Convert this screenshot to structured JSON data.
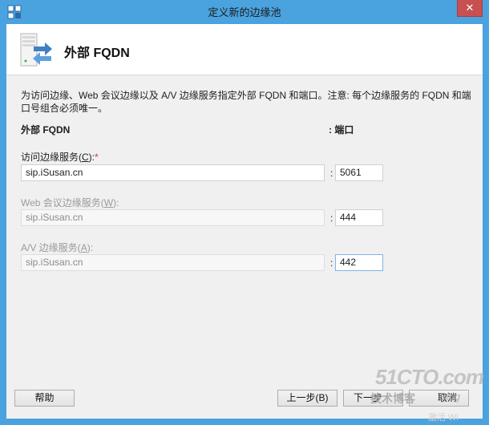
{
  "window": {
    "title": "定义新的边缘池",
    "close_label": "✕"
  },
  "header": {
    "title": "外部 FQDN",
    "icon": "server-arrow-icon"
  },
  "description": "为访问边缘、Web 会议边缘以及 A/V 边缘服务指定外部 FQDN 和端口。注意: 每个边缘服务的 FQDN 和端口号组合必须唯一。",
  "columns": {
    "fqdn": "外部 FQDN",
    "port": ": 端口"
  },
  "fields": [
    {
      "label_prefix": "访问边缘服务(",
      "label_key": "C",
      "label_suffix": "):",
      "required_mark": "*",
      "fqdn": "sip.iSusan.cn",
      "port": "5061",
      "enabled": true
    },
    {
      "label_prefix": "Web 会议边缘服务(",
      "label_key": "W",
      "label_suffix": "):",
      "required_mark": "",
      "fqdn": "sip.iSusan.cn",
      "port": "444",
      "enabled": false
    },
    {
      "label_prefix": "A/V 边缘服务(",
      "label_key": "A",
      "label_suffix": "):",
      "required_mark": "",
      "fqdn": "sip.iSusan.cn",
      "port": "442",
      "enabled": false
    }
  ],
  "colon": ":",
  "buttons": {
    "help": "帮助",
    "back": "上一步(B)",
    "next": "下一步",
    "cancel": "取消"
  },
  "watermark": {
    "main": "51CTO.com",
    "sub": "技术博客",
    "blog": "Blog",
    "foot": "激活 Wi"
  },
  "colors": {
    "titlebar": "#4aa3df",
    "close": "#c75050",
    "required": "#dd3333"
  }
}
